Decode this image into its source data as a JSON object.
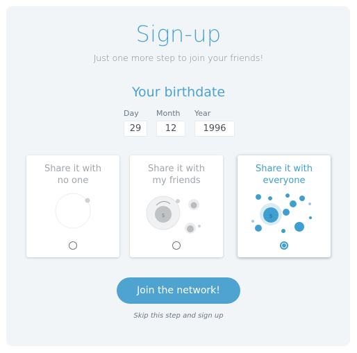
{
  "header": {
    "title": "Sign-up",
    "subtitle": "Just one more step to join your friends!"
  },
  "birthdate": {
    "heading": "Your birthdate",
    "day_label": "Day",
    "day_value": "29",
    "month_label": "Month",
    "month_value": "12",
    "year_label": "Year",
    "year_value": "1996"
  },
  "share_options": [
    {
      "line1": "Share it with",
      "line2": "no one",
      "selected": false
    },
    {
      "line1": "Share it with",
      "line2": "my friends",
      "selected": false
    },
    {
      "line1": "Share it with",
      "line2": "everyone",
      "selected": true
    }
  ],
  "actions": {
    "join_label": "Join the network!",
    "skip_label": "Skip this step and sign up"
  },
  "colors": {
    "accent": "#4aa3cf",
    "panel_bg": "#f2f5f8",
    "muted": "#a0a6ab"
  }
}
